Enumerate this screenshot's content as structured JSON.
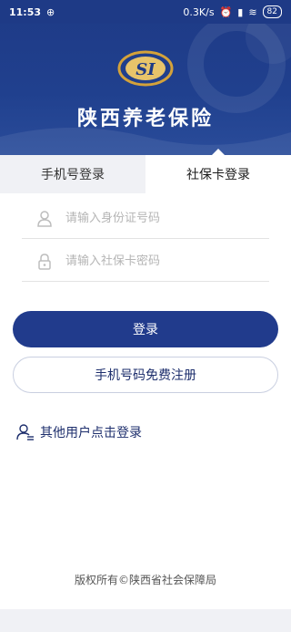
{
  "status": {
    "time": "11:53",
    "speed": "0.3K/s",
    "battery": "82"
  },
  "header": {
    "title": "陕西养老保险",
    "logo_text": "SI"
  },
  "tabs": [
    {
      "label": "手机号登录",
      "active": false
    },
    {
      "label": "社保卡登录",
      "active": true
    }
  ],
  "form": {
    "id_placeholder": "请输入身份证号码",
    "password_placeholder": "请输入社保卡密码"
  },
  "buttons": {
    "login": "登录",
    "register": "手机号码免费注册"
  },
  "other_login": "其他用户点击登录",
  "footer": {
    "copyright": "版权所有©陕西省社会保障局"
  },
  "colors": {
    "primary": "#213b8c",
    "header": "#1e3a86",
    "gold": "#d4a23a"
  }
}
